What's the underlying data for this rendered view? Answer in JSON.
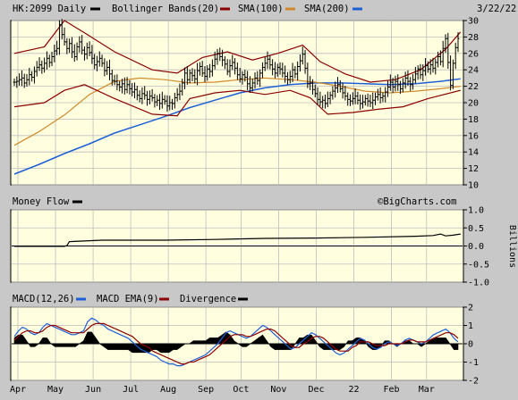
{
  "chart_data": [
    {
      "type": "ohlc",
      "panel": "price",
      "legend": {
        "symbol": "HK:2099 Daily",
        "items": [
          {
            "label": "Bollinger Bands(20)",
            "color": "#8b0000"
          },
          {
            "label": "SMA(100)",
            "color": "#d08a2c"
          },
          {
            "label": "SMA(200)",
            "color": "#1f5fd6"
          }
        ],
        "symbol_color": "#000000"
      },
      "date_label": "3/22/22",
      "ylim": [
        10,
        30
      ],
      "yticks": [
        10,
        12,
        14,
        16,
        18,
        20,
        22,
        24,
        26,
        28,
        30
      ],
      "x_months": [
        "Apr",
        "May",
        "Jun",
        "Jul",
        "Aug",
        "Sep",
        "Oct",
        "Nov",
        "Dec",
        "22",
        "Feb",
        "Mar"
      ],
      "close_series": [
        22.5,
        22.6,
        22.8,
        23.0,
        22.4,
        22.8,
        23.4,
        23.1,
        23.8,
        24.3,
        24.6,
        24.2,
        24.8,
        25.4,
        24.9,
        25.6,
        26.3,
        26.6,
        29.5,
        28.3,
        27.4,
        26.6,
        27.2,
        26.2,
        25.6,
        26.8,
        27.4,
        26.4,
        25.9,
        26.7,
        26.1,
        25.4,
        24.6,
        25.0,
        25.4,
        24.8,
        23.9,
        24.3,
        23.5,
        22.7,
        22.6,
        22.2,
        21.9,
        22.3,
        21.6,
        22.2,
        21.7,
        21.3,
        21.6,
        20.9,
        20.5,
        21.1,
        20.9,
        20.4,
        20.8,
        20.6,
        20.1,
        20.3,
        19.9,
        20.4,
        20.2,
        19.6,
        20.0,
        19.9,
        20.6,
        21.0,
        21.4,
        22.4,
        23.6,
        22.8,
        23.6,
        23.3,
        22.9,
        23.9,
        24.4,
        23.6,
        23.2,
        24.1,
        23.8,
        24.5,
        25.3,
        26.0,
        25.6,
        25.2,
        24.7,
        23.8,
        24.5,
        24.9,
        24.2,
        23.4,
        22.9,
        23.4,
        23.1,
        22.3,
        21.8,
        22.4,
        23.0,
        22.7,
        23.6,
        24.3,
        24.8,
        25.3,
        24.6,
        24.1,
        23.6,
        24.3,
        24.1,
        23.6,
        23.2,
        22.8,
        23.2,
        24.0,
        23.5,
        24.4,
        25.1,
        25.9,
        24.2,
        22.3,
        22.4,
        21.6,
        21.1,
        20.4,
        20.1,
        20.3,
        19.9,
        20.5,
        20.9,
        21.4,
        21.8,
        22.2,
        21.7,
        21.2,
        20.8,
        20.4,
        20.2,
        20.5,
        20.8,
        20.3,
        19.9,
        20.1,
        20.5,
        20.2,
        20.0,
        20.3,
        20.7,
        21.0,
        20.6,
        20.8,
        21.3,
        21.9,
        22.5,
        21.9,
        22.6,
        22.2,
        21.7,
        22.4,
        23.0,
        22.6,
        22.2,
        22.8,
        23.5,
        24.1,
        23.4,
        23.9,
        24.5,
        24.1,
        24.6,
        24.2,
        24.9,
        25.6,
        25.0,
        26.6,
        27.8,
        24.9,
        22.1,
        24.8,
        26.7,
        27.8
      ],
      "boll_upper": [
        [
          0,
          26.0
        ],
        [
          12,
          26.8
        ],
        [
          20,
          30.0
        ],
        [
          28,
          28.5
        ],
        [
          40,
          26.2
        ],
        [
          55,
          24.0
        ],
        [
          65,
          23.6
        ],
        [
          75,
          25.5
        ],
        [
          85,
          26.2
        ],
        [
          95,
          25.2
        ],
        [
          105,
          26.0
        ],
        [
          115,
          27.0
        ],
        [
          122,
          25.0
        ],
        [
          132,
          23.5
        ],
        [
          142,
          22.5
        ],
        [
          152,
          22.8
        ],
        [
          162,
          24.0
        ],
        [
          172,
          26.5
        ],
        [
          178,
          28.6
        ]
      ],
      "boll_lower": [
        [
          0,
          19.5
        ],
        [
          12,
          20.0
        ],
        [
          20,
          21.5
        ],
        [
          28,
          22.2
        ],
        [
          40,
          20.5
        ],
        [
          55,
          18.6
        ],
        [
          65,
          18.4
        ],
        [
          70,
          20.5
        ],
        [
          80,
          21.2
        ],
        [
          90,
          21.5
        ],
        [
          100,
          21.0
        ],
        [
          110,
          21.5
        ],
        [
          118,
          20.6
        ],
        [
          125,
          18.6
        ],
        [
          135,
          18.8
        ],
        [
          145,
          19.2
        ],
        [
          155,
          19.5
        ],
        [
          165,
          20.5
        ],
        [
          178,
          21.5
        ]
      ],
      "sma100": [
        [
          0,
          14.8
        ],
        [
          10,
          16.5
        ],
        [
          20,
          18.5
        ],
        [
          30,
          21.0
        ],
        [
          40,
          22.6
        ],
        [
          50,
          23.0
        ],
        [
          60,
          22.8
        ],
        [
          70,
          22.4
        ],
        [
          80,
          22.5
        ],
        [
          90,
          22.8
        ],
        [
          100,
          23.0
        ],
        [
          110,
          22.8
        ],
        [
          120,
          22.5
        ],
        [
          130,
          22.0
        ],
        [
          140,
          21.4
        ],
        [
          150,
          21.2
        ],
        [
          160,
          21.4
        ],
        [
          170,
          21.7
        ],
        [
          178,
          22.0
        ]
      ],
      "sma200": [
        [
          0,
          11.3
        ],
        [
          10,
          12.5
        ],
        [
          20,
          13.8
        ],
        [
          30,
          15.0
        ],
        [
          40,
          16.3
        ],
        [
          50,
          17.3
        ],
        [
          60,
          18.3
        ],
        [
          70,
          19.4
        ],
        [
          80,
          20.3
        ],
        [
          90,
          21.2
        ],
        [
          100,
          21.8
        ],
        [
          110,
          22.2
        ],
        [
          120,
          22.4
        ],
        [
          130,
          22.4
        ],
        [
          140,
          22.3
        ],
        [
          150,
          22.2
        ],
        [
          160,
          22.3
        ],
        [
          170,
          22.6
        ],
        [
          178,
          22.9
        ]
      ]
    },
    {
      "type": "line",
      "panel": "money_flow",
      "legend": {
        "label": "Money Flow",
        "color": "#000000"
      },
      "watermark": "©BigCharts.com",
      "ylim": [
        -1.0,
        1.0
      ],
      "yticks": [
        1.0,
        0.5,
        0.0,
        -0.5,
        -1.0
      ],
      "ylabel": "Billions",
      "values": [
        [
          0,
          -0.01
        ],
        [
          20,
          -0.01
        ],
        [
          21,
          0.01
        ],
        [
          22,
          0.12
        ],
        [
          35,
          0.16
        ],
        [
          60,
          0.16
        ],
        [
          80,
          0.18
        ],
        [
          100,
          0.21
        ],
        [
          120,
          0.22
        ],
        [
          140,
          0.24
        ],
        [
          160,
          0.27
        ],
        [
          167,
          0.29
        ],
        [
          170,
          0.33
        ],
        [
          172,
          0.28
        ],
        [
          175,
          0.3
        ],
        [
          178,
          0.33
        ]
      ],
      "zero_line": 0.0
    },
    {
      "type": "line+bar",
      "panel": "macd",
      "legend": [
        {
          "label": "MACD(12,26)",
          "color": "#000000"
        },
        {
          "label": "MACD EMA(9)",
          "color": "#1f5fd6"
        },
        {
          "label": "Divergence",
          "color": "#8b0000"
        },
        {
          "label": "",
          "color": "#000000"
        }
      ],
      "ylim": [
        -2,
        2
      ],
      "yticks": [
        2,
        1,
        0,
        -1,
        -2
      ],
      "macd": [
        0.4,
        0.7,
        0.9,
        0.8,
        0.6,
        0.5,
        0.6,
        0.9,
        1.1,
        1.0,
        0.9,
        0.8,
        0.7,
        0.6,
        0.5,
        0.5,
        0.6,
        0.7,
        1.2,
        1.4,
        1.3,
        1.1,
        1.0,
        0.8,
        0.7,
        0.6,
        0.5,
        0.4,
        0.3,
        0.1,
        -0.1,
        -0.3,
        -0.4,
        -0.5,
        -0.6,
        -0.7,
        -0.9,
        -1.0,
        -1.1,
        -1.1,
        -1.2,
        -1.2,
        -1.1,
        -1.0,
        -0.9,
        -0.8,
        -0.7,
        -0.6,
        -0.4,
        -0.2,
        0.0,
        0.3,
        0.6,
        0.7,
        0.6,
        0.5,
        0.4,
        0.3,
        0.4,
        0.6,
        0.8,
        1.0,
        0.9,
        0.7,
        0.5,
        0.3,
        0.1,
        -0.1,
        -0.3,
        -0.2,
        0.0,
        0.2,
        0.4,
        0.6,
        0.5,
        0.3,
        0.1,
        -0.1,
        -0.3,
        -0.5,
        -0.6,
        -0.5,
        -0.3,
        -0.1,
        0.1,
        0.3,
        0.2,
        0.0,
        -0.2,
        -0.3,
        -0.2,
        0.0,
        0.1,
        0.0,
        -0.1,
        0.0,
        0.2,
        0.3,
        0.2,
        0.1,
        0.0,
        0.1,
        0.3,
        0.5,
        0.6,
        0.7,
        0.8,
        0.6,
        0.3,
        0.1
      ],
      "signal": [
        0.2,
        0.4,
        0.6,
        0.7,
        0.7,
        0.6,
        0.6,
        0.7,
        0.9,
        1.0,
        1.0,
        0.9,
        0.8,
        0.7,
        0.6,
        0.6,
        0.6,
        0.6,
        0.8,
        1.0,
        1.1,
        1.1,
        1.1,
        1.0,
        0.9,
        0.8,
        0.7,
        0.6,
        0.5,
        0.4,
        0.2,
        0.0,
        -0.1,
        -0.2,
        -0.4,
        -0.5,
        -0.6,
        -0.7,
        -0.8,
        -0.9,
        -1.0,
        -1.1,
        -1.1,
        -1.0,
        -1.0,
        -0.9,
        -0.8,
        -0.7,
        -0.6,
        -0.4,
        -0.2,
        0.0,
        0.2,
        0.4,
        0.5,
        0.5,
        0.5,
        0.4,
        0.4,
        0.5,
        0.6,
        0.7,
        0.8,
        0.8,
        0.7,
        0.5,
        0.3,
        0.1,
        -0.1,
        -0.2,
        -0.2,
        0.0,
        0.1,
        0.3,
        0.4,
        0.4,
        0.3,
        0.1,
        -0.1,
        -0.3,
        -0.4,
        -0.4,
        -0.4,
        -0.2,
        -0.1,
        0.1,
        0.1,
        0.1,
        0.0,
        -0.1,
        -0.1,
        -0.1,
        0.0,
        0.0,
        0.0,
        0.0,
        0.1,
        0.2,
        0.2,
        0.1,
        0.1,
        0.1,
        0.2,
        0.3,
        0.4,
        0.5,
        0.6,
        0.6,
        0.5,
        0.3
      ]
    }
  ]
}
